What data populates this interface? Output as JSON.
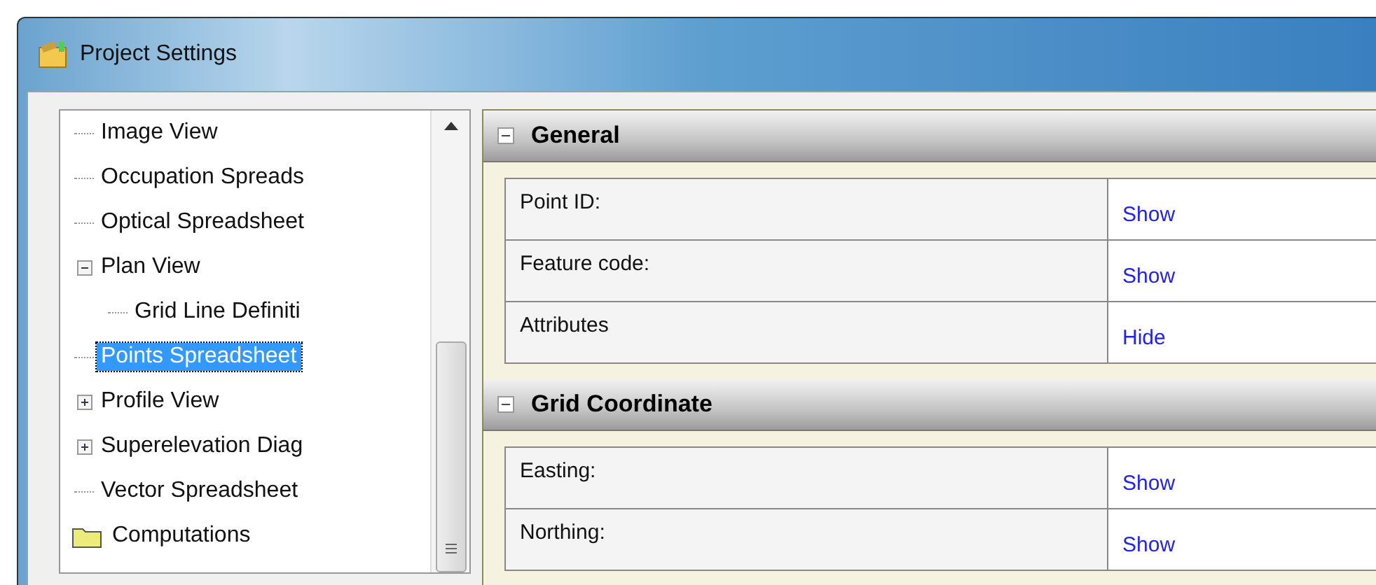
{
  "window": {
    "title": "Project Settings"
  },
  "tree": {
    "items": [
      {
        "label": "Image View",
        "selected": false
      },
      {
        "label": "Occupation Spreads",
        "selected": false
      },
      {
        "label": "Optical Spreadsheet",
        "selected": false
      },
      {
        "label": "Plan View",
        "selected": false,
        "expanded": true,
        "children": [
          {
            "label": "Grid Line Definiti",
            "selected": false
          }
        ]
      },
      {
        "label": "Points Spreadsheet",
        "selected": true
      },
      {
        "label": "Profile View",
        "selected": false,
        "expanded": false
      },
      {
        "label": "Superelevation Diag",
        "selected": false,
        "expanded": false
      },
      {
        "label": "Vector Spreadsheet",
        "selected": false
      }
    ],
    "root_items": [
      {
        "label": "Computations",
        "selected": false
      }
    ]
  },
  "sections": [
    {
      "title": "General",
      "expanded": true,
      "rows": [
        {
          "label": "Point ID:",
          "value": "Show"
        },
        {
          "label": "Feature code:",
          "value": "Show"
        },
        {
          "label": "Attributes",
          "value": "Hide"
        }
      ]
    },
    {
      "title": "Grid Coordinate",
      "expanded": true,
      "rows": [
        {
          "label": "Easting:",
          "value": "Show"
        },
        {
          "label": "Northing:",
          "value": "Show"
        }
      ]
    }
  ]
}
